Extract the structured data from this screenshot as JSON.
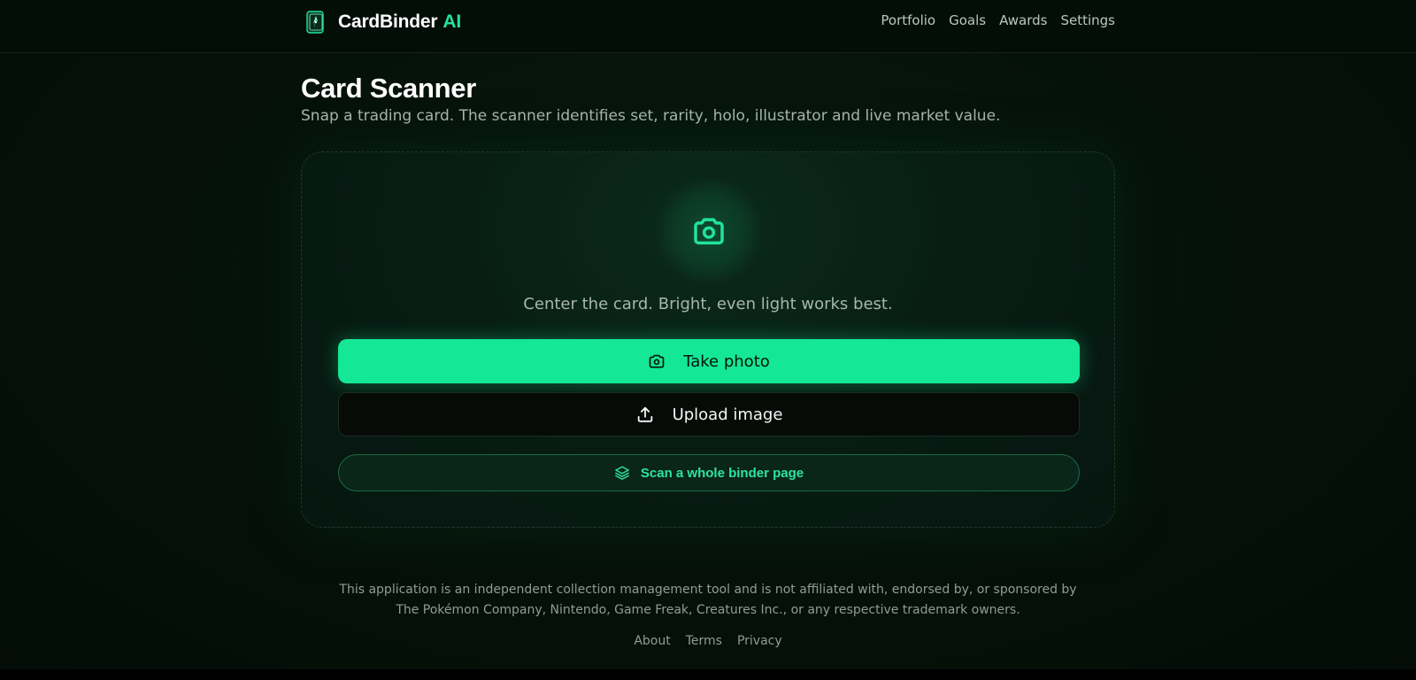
{
  "brand": {
    "name": "CardBinder",
    "accent": "AI",
    "logo_icon": "card-binder-logo-icon"
  },
  "nav": {
    "items": [
      "Portfolio",
      "Goals",
      "Awards",
      "Settings"
    ]
  },
  "page": {
    "title": "Card Scanner",
    "subtitle": "Snap a trading card. The scanner identifies set, rarity, holo, illustrator and live market value."
  },
  "scanner": {
    "hero_icon": "camera-icon",
    "hint": "Center the card. Bright, even light works best.",
    "take_photo_label": "Take photo",
    "take_photo_icon": "camera-icon",
    "upload_label": "Upload image",
    "upload_icon": "upload-icon",
    "binder_label": "Scan a whole binder page",
    "binder_icon": "layers-icon"
  },
  "footer": {
    "disclaimer_line1": "This application is an independent collection management tool and is not affiliated with, endorsed by, or sponsored by",
    "disclaimer_line2": "The Pokémon Company, Nintendo, Game Freak, Creatures Inc., or any respective trademark owners.",
    "links": [
      "About",
      "Terms",
      "Privacy"
    ]
  },
  "colors": {
    "accent": "#14e896",
    "accent_text": "#22e39a",
    "background": "#051109",
    "card_border": "#1d3a2b"
  }
}
